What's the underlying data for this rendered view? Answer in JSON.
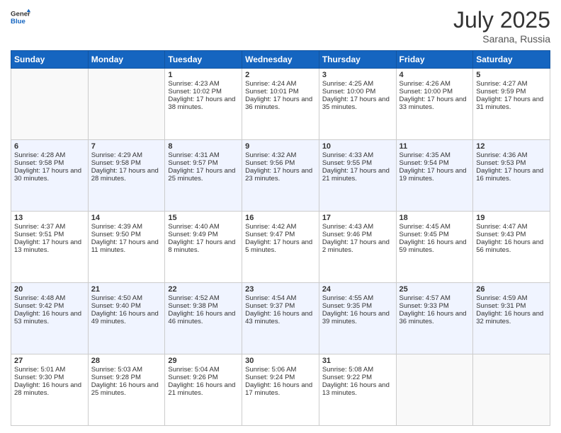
{
  "header": {
    "logo_general": "General",
    "logo_blue": "Blue",
    "month_year": "July 2025",
    "location": "Sarana, Russia"
  },
  "days_of_week": [
    "Sunday",
    "Monday",
    "Tuesday",
    "Wednesday",
    "Thursday",
    "Friday",
    "Saturday"
  ],
  "weeks": [
    [
      {
        "day": "",
        "info": ""
      },
      {
        "day": "",
        "info": ""
      },
      {
        "day": "1",
        "info": "Sunrise: 4:23 AM\nSunset: 10:02 PM\nDaylight: 17 hours and 38 minutes."
      },
      {
        "day": "2",
        "info": "Sunrise: 4:24 AM\nSunset: 10:01 PM\nDaylight: 17 hours and 36 minutes."
      },
      {
        "day": "3",
        "info": "Sunrise: 4:25 AM\nSunset: 10:00 PM\nDaylight: 17 hours and 35 minutes."
      },
      {
        "day": "4",
        "info": "Sunrise: 4:26 AM\nSunset: 10:00 PM\nDaylight: 17 hours and 33 minutes."
      },
      {
        "day": "5",
        "info": "Sunrise: 4:27 AM\nSunset: 9:59 PM\nDaylight: 17 hours and 31 minutes."
      }
    ],
    [
      {
        "day": "6",
        "info": "Sunrise: 4:28 AM\nSunset: 9:58 PM\nDaylight: 17 hours and 30 minutes."
      },
      {
        "day": "7",
        "info": "Sunrise: 4:29 AM\nSunset: 9:58 PM\nDaylight: 17 hours and 28 minutes."
      },
      {
        "day": "8",
        "info": "Sunrise: 4:31 AM\nSunset: 9:57 PM\nDaylight: 17 hours and 25 minutes."
      },
      {
        "day": "9",
        "info": "Sunrise: 4:32 AM\nSunset: 9:56 PM\nDaylight: 17 hours and 23 minutes."
      },
      {
        "day": "10",
        "info": "Sunrise: 4:33 AM\nSunset: 9:55 PM\nDaylight: 17 hours and 21 minutes."
      },
      {
        "day": "11",
        "info": "Sunrise: 4:35 AM\nSunset: 9:54 PM\nDaylight: 17 hours and 19 minutes."
      },
      {
        "day": "12",
        "info": "Sunrise: 4:36 AM\nSunset: 9:53 PM\nDaylight: 17 hours and 16 minutes."
      }
    ],
    [
      {
        "day": "13",
        "info": "Sunrise: 4:37 AM\nSunset: 9:51 PM\nDaylight: 17 hours and 13 minutes."
      },
      {
        "day": "14",
        "info": "Sunrise: 4:39 AM\nSunset: 9:50 PM\nDaylight: 17 hours and 11 minutes."
      },
      {
        "day": "15",
        "info": "Sunrise: 4:40 AM\nSunset: 9:49 PM\nDaylight: 17 hours and 8 minutes."
      },
      {
        "day": "16",
        "info": "Sunrise: 4:42 AM\nSunset: 9:47 PM\nDaylight: 17 hours and 5 minutes."
      },
      {
        "day": "17",
        "info": "Sunrise: 4:43 AM\nSunset: 9:46 PM\nDaylight: 17 hours and 2 minutes."
      },
      {
        "day": "18",
        "info": "Sunrise: 4:45 AM\nSunset: 9:45 PM\nDaylight: 16 hours and 59 minutes."
      },
      {
        "day": "19",
        "info": "Sunrise: 4:47 AM\nSunset: 9:43 PM\nDaylight: 16 hours and 56 minutes."
      }
    ],
    [
      {
        "day": "20",
        "info": "Sunrise: 4:48 AM\nSunset: 9:42 PM\nDaylight: 16 hours and 53 minutes."
      },
      {
        "day": "21",
        "info": "Sunrise: 4:50 AM\nSunset: 9:40 PM\nDaylight: 16 hours and 49 minutes."
      },
      {
        "day": "22",
        "info": "Sunrise: 4:52 AM\nSunset: 9:38 PM\nDaylight: 16 hours and 46 minutes."
      },
      {
        "day": "23",
        "info": "Sunrise: 4:54 AM\nSunset: 9:37 PM\nDaylight: 16 hours and 43 minutes."
      },
      {
        "day": "24",
        "info": "Sunrise: 4:55 AM\nSunset: 9:35 PM\nDaylight: 16 hours and 39 minutes."
      },
      {
        "day": "25",
        "info": "Sunrise: 4:57 AM\nSunset: 9:33 PM\nDaylight: 16 hours and 36 minutes."
      },
      {
        "day": "26",
        "info": "Sunrise: 4:59 AM\nSunset: 9:31 PM\nDaylight: 16 hours and 32 minutes."
      }
    ],
    [
      {
        "day": "27",
        "info": "Sunrise: 5:01 AM\nSunset: 9:30 PM\nDaylight: 16 hours and 28 minutes."
      },
      {
        "day": "28",
        "info": "Sunrise: 5:03 AM\nSunset: 9:28 PM\nDaylight: 16 hours and 25 minutes."
      },
      {
        "day": "29",
        "info": "Sunrise: 5:04 AM\nSunset: 9:26 PM\nDaylight: 16 hours and 21 minutes."
      },
      {
        "day": "30",
        "info": "Sunrise: 5:06 AM\nSunset: 9:24 PM\nDaylight: 16 hours and 17 minutes."
      },
      {
        "day": "31",
        "info": "Sunrise: 5:08 AM\nSunset: 9:22 PM\nDaylight: 16 hours and 13 minutes."
      },
      {
        "day": "",
        "info": ""
      },
      {
        "day": "",
        "info": ""
      }
    ]
  ]
}
